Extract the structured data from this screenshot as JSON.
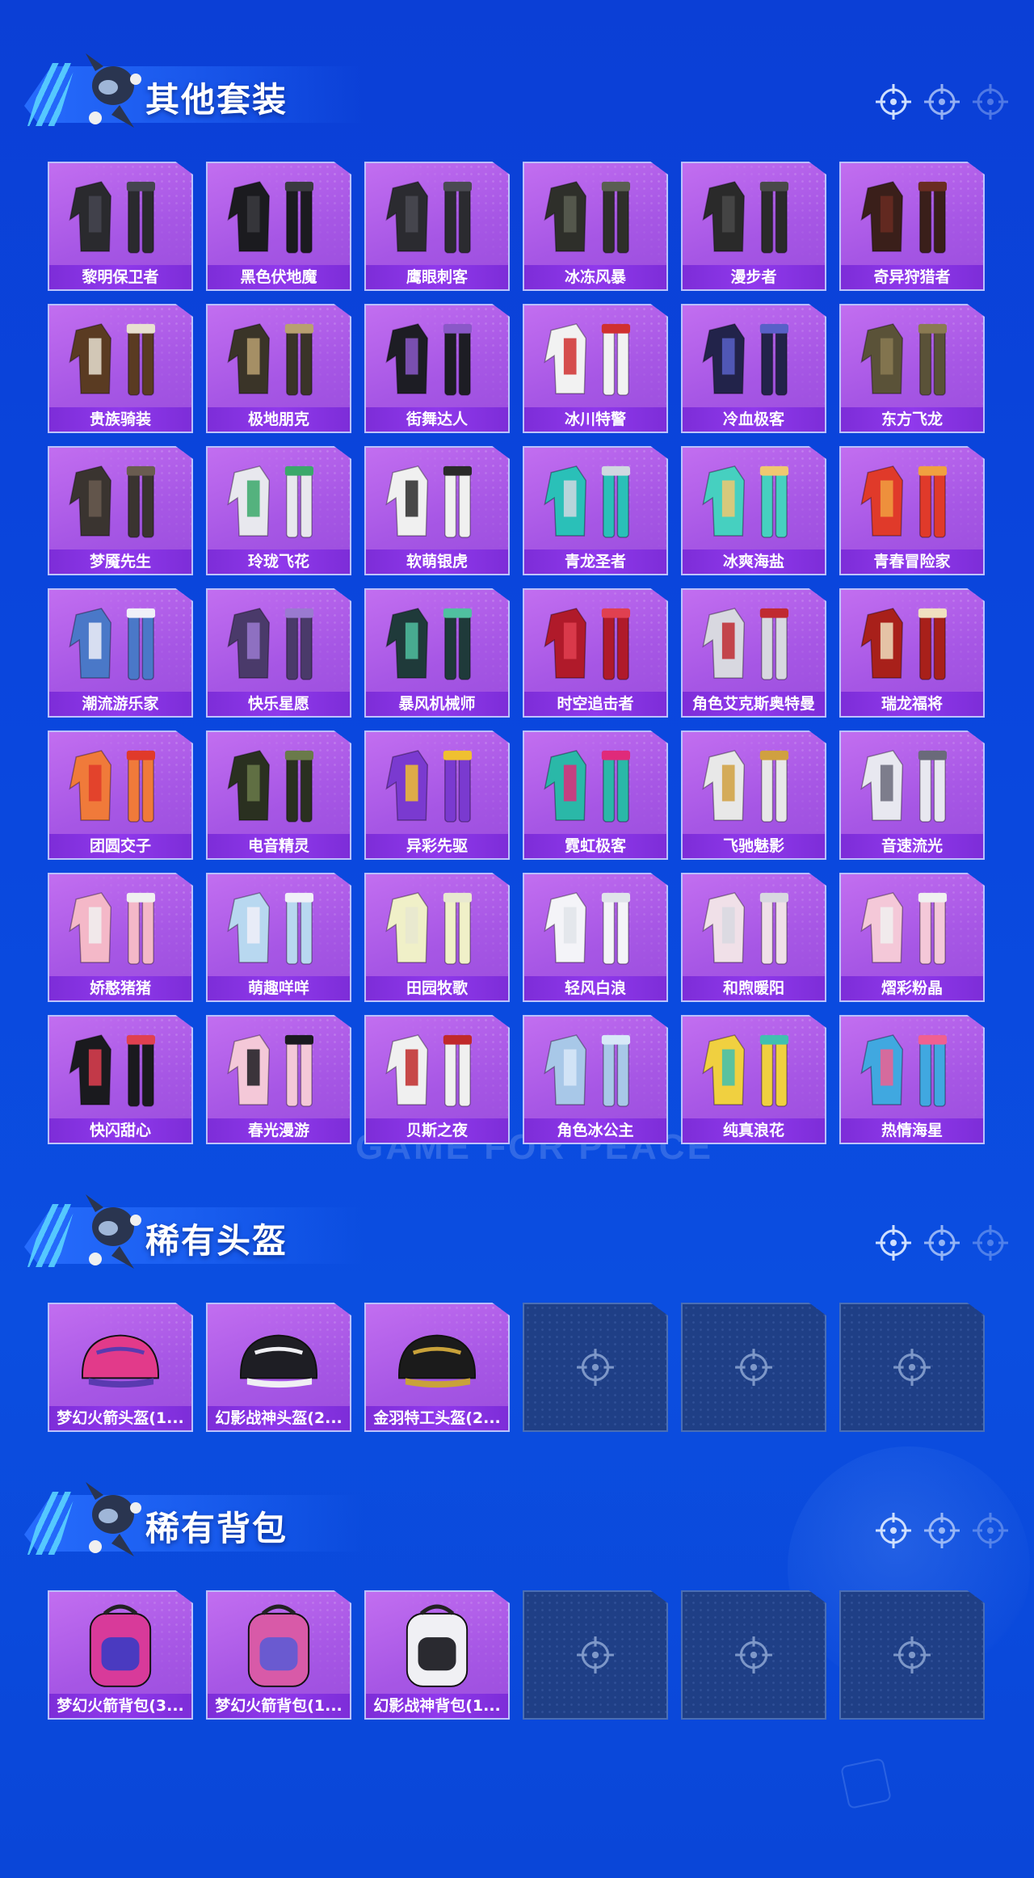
{
  "sections": [
    {
      "title": "其他套装",
      "items": [
        {
          "name": "黎明保卫者",
          "palette": [
            "#2a2a2e",
            "#454550"
          ]
        },
        {
          "name": "黑色伏地魔",
          "palette": [
            "#1b1b1f",
            "#3a3a40"
          ]
        },
        {
          "name": "鹰眼刺客",
          "palette": [
            "#2b2b30",
            "#4a4a52"
          ]
        },
        {
          "name": "冰冻风暴",
          "palette": [
            "#2e2f2a",
            "#5a5e52"
          ]
        },
        {
          "name": "漫步者",
          "palette": [
            "#2a2a2a",
            "#494949"
          ]
        },
        {
          "name": "奇异狩猎者",
          "palette": [
            "#3a1f1a",
            "#6a2c22"
          ]
        },
        {
          "name": "贵族骑装",
          "palette": [
            "#5a3b22",
            "#e8e0d0"
          ]
        },
        {
          "name": "极地朋克",
          "palette": [
            "#3a3428",
            "#b8a070"
          ]
        },
        {
          "name": "街舞达人",
          "palette": [
            "#1d1d24",
            "#8a58c8"
          ]
        },
        {
          "name": "冰川特警",
          "palette": [
            "#f2f2f2",
            "#d03030"
          ]
        },
        {
          "name": "冷血极客",
          "palette": [
            "#22234a",
            "#5860c8"
          ]
        },
        {
          "name": "东方飞龙",
          "palette": [
            "#5a5238",
            "#8a7a52"
          ]
        },
        {
          "name": "梦魇先生",
          "palette": [
            "#3a3430",
            "#6a5c50"
          ]
        },
        {
          "name": "玲珑飞花",
          "palette": [
            "#e8e8ee",
            "#3aa86a"
          ]
        },
        {
          "name": "软萌银虎",
          "palette": [
            "#f0f0f0",
            "#2a2a2a"
          ]
        },
        {
          "name": "青龙圣者",
          "palette": [
            "#2ac0b8",
            "#d0d8e0"
          ]
        },
        {
          "name": "冰爽海盐",
          "palette": [
            "#46d0c0",
            "#f0c870"
          ]
        },
        {
          "name": "青春冒险家",
          "palette": [
            "#e03a2a",
            "#f0a040"
          ]
        },
        {
          "name": "潮流游乐家",
          "palette": [
            "#4a78c8",
            "#f0f0f8"
          ]
        },
        {
          "name": "快乐星愿",
          "palette": [
            "#4a3a6a",
            "#9a7ad0"
          ]
        },
        {
          "name": "暴风机械师",
          "palette": [
            "#1f3a3a",
            "#50c0a0"
          ]
        },
        {
          "name": "时空追击者",
          "palette": [
            "#b01a2a",
            "#e04050"
          ]
        },
        {
          "name": "角色艾克斯奥特曼",
          "palette": [
            "#d8d8e0",
            "#c02a30"
          ]
        },
        {
          "name": "瑞龙福将",
          "palette": [
            "#a8201a",
            "#f0e0c0"
          ]
        },
        {
          "name": "团圆交子",
          "palette": [
            "#f07a3a",
            "#e03a2a"
          ]
        },
        {
          "name": "电音精灵",
          "palette": [
            "#2a3020",
            "#6a7a4a"
          ]
        },
        {
          "name": "异彩先驱",
          "palette": [
            "#7a3ad0",
            "#f0c030"
          ]
        },
        {
          "name": "霓虹极客",
          "palette": [
            "#2ab8a8",
            "#e02a7a"
          ]
        },
        {
          "name": "飞驰魅影",
          "palette": [
            "#e8e8e8",
            "#d0a040"
          ]
        },
        {
          "name": "音速流光",
          "palette": [
            "#e8e8f0",
            "#6a6a7a"
          ]
        },
        {
          "name": "娇憨猪猪",
          "palette": [
            "#f4b8c8",
            "#f0f0f0"
          ]
        },
        {
          "name": "萌趣咩咩",
          "palette": [
            "#b8d8f0",
            "#f0f0f8"
          ]
        },
        {
          "name": "田园牧歌",
          "palette": [
            "#f0f0c8",
            "#e8e8d0"
          ]
        },
        {
          "name": "轻风白浪",
          "palette": [
            "#f4f4f8",
            "#e0e4ea"
          ]
        },
        {
          "name": "和煦暖阳",
          "palette": [
            "#f0e0e8",
            "#d8d8e0"
          ]
        },
        {
          "name": "熠彩粉晶",
          "palette": [
            "#f4c8d8",
            "#f0f0f0"
          ]
        },
        {
          "name": "快闪甜心",
          "palette": [
            "#1a1a1e",
            "#e04050"
          ]
        },
        {
          "name": "春光漫游",
          "palette": [
            "#f4c8d8",
            "#1a1a20"
          ]
        },
        {
          "name": "贝斯之夜",
          "palette": [
            "#f0f0f0",
            "#c02a2a"
          ]
        },
        {
          "name": "角色冰公主",
          "palette": [
            "#a8c8e8",
            "#d8e8f8"
          ]
        },
        {
          "name": "纯真浪花",
          "palette": [
            "#f0d040",
            "#40c0b0"
          ]
        },
        {
          "name": "热情海星",
          "palette": [
            "#40a8e0",
            "#f06090"
          ]
        }
      ]
    },
    {
      "title": "稀有头盔",
      "items": [
        {
          "name": "梦幻火箭头盔(1...",
          "palette": [
            "#e23a8a",
            "#5a3ab0"
          ]
        },
        {
          "name": "幻影战神头盔(2...",
          "palette": [
            "#1e1e24",
            "#f0f0f4"
          ]
        },
        {
          "name": "金羽特工头盔(2...",
          "palette": [
            "#1b1b1b",
            "#c9a23a"
          ]
        },
        {
          "empty": true
        },
        {
          "empty": true
        },
        {
          "empty": true
        }
      ]
    },
    {
      "title": "稀有背包",
      "items": [
        {
          "name": "梦幻火箭背包(3...",
          "palette": [
            "#d83a9a",
            "#4a3ac0"
          ]
        },
        {
          "name": "梦幻火箭背包(1...",
          "palette": [
            "#d85aa8",
            "#6a5ad0"
          ]
        },
        {
          "name": "幻影战神背包(1...",
          "palette": [
            "#f0f0f4",
            "#2a2a30"
          ]
        },
        {
          "empty": true
        },
        {
          "empty": true
        },
        {
          "empty": true
        }
      ]
    }
  ],
  "watermark": "GAME FOR PEACE",
  "colors": {
    "accent": "#8a37ea",
    "background": "#0b45da",
    "card": "#b163ea",
    "empty_card": "#1f3f86"
  }
}
